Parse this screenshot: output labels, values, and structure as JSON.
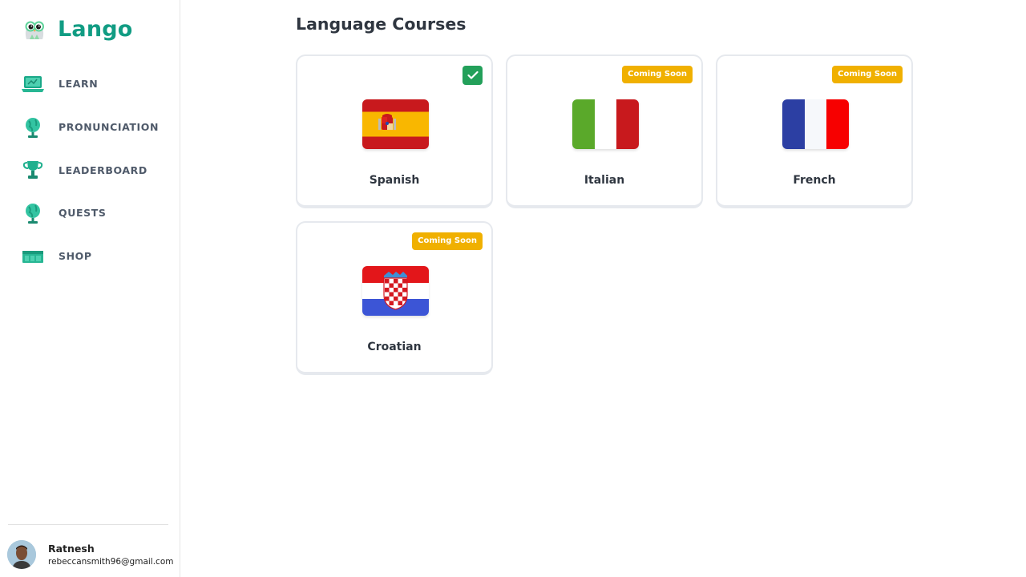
{
  "brand": {
    "name": "Lango",
    "icon": "owl-mascot-icon",
    "color": "#119c83"
  },
  "sidebar": {
    "items": [
      {
        "label": "LEARN",
        "icon": "laptop-icon"
      },
      {
        "label": "PRONUNCIATION",
        "icon": "globe-icon"
      },
      {
        "label": "LEADERBOARD",
        "icon": "trophy-icon"
      },
      {
        "label": "QUESTS",
        "icon": "globe-icon"
      },
      {
        "label": "SHOP",
        "icon": "shop-icon"
      }
    ]
  },
  "user": {
    "name": "Ratnesh",
    "email": "rebeccansmith96@gmail.com",
    "icon": "avatar-photo"
  },
  "main": {
    "title": "Language Courses",
    "courses": [
      {
        "name": "Spanish",
        "status": "selected",
        "flag": "spain-flag"
      },
      {
        "name": "Italian",
        "status": "Coming Soon",
        "flag": "italy-flag"
      },
      {
        "name": "French",
        "status": "Coming Soon",
        "flag": "france-flag"
      },
      {
        "name": "Croatian",
        "status": "Coming Soon",
        "flag": "croatia-flag"
      }
    ]
  },
  "colors": {
    "badge": "#f0b000",
    "selected": "#23a05a",
    "accent": "#119c83"
  }
}
